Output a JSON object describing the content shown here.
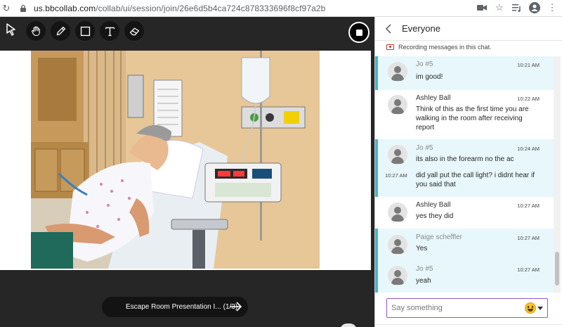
{
  "browser": {
    "url_host": "us.bbcollab.com",
    "url_path": "/collab/ui/session/join/26e6d5b4ca724c878333696f8cf97a2b"
  },
  "toolbar": {
    "tools": [
      {
        "name": "select-tool",
        "icon": "arrow-cursor-icon"
      },
      {
        "name": "pan-tool",
        "icon": "hand-icon"
      },
      {
        "name": "pen-tool",
        "icon": "pencil-icon"
      },
      {
        "name": "shape-tool",
        "icon": "square-icon"
      },
      {
        "name": "text-tool",
        "icon": "text-t-icon"
      },
      {
        "name": "eraser-tool",
        "icon": "eraser-icon"
      }
    ]
  },
  "presentation": {
    "title": "Escape Room Presentation I...",
    "page_count": "(1/3)"
  },
  "chat": {
    "title": "Everyone",
    "recording_note": "Recording messages in this chat.",
    "messages": [
      {
        "sender": "Jo #5",
        "time": "10:21 AM",
        "text": "im good!"
      },
      {
        "sender": "Ashley Ball",
        "time": "10:22 AM",
        "text": "Think of this as the first time you are walking in the room after receiving report"
      },
      {
        "sender": "Jo #5",
        "time": "10:24 AM",
        "text": "its also in the forearm no the ac",
        "followup_time": "10:27 AM",
        "followup_text": "did yall put the call light? i didnt hear if you said that"
      },
      {
        "sender": "Ashley Ball",
        "time": "10:27 AM",
        "text": "yes they did"
      },
      {
        "sender": "Paige scheffler",
        "time": "10:27 AM",
        "text": "Yes"
      },
      {
        "sender": "Jo #5",
        "time": "10:27 AM",
        "text": "yeah"
      }
    ],
    "compose_placeholder": "Say something"
  },
  "colors": {
    "highlight_bg": "#e8f7fb",
    "highlight_border": "#3fb6d8",
    "compose_border": "#8e58d1"
  }
}
